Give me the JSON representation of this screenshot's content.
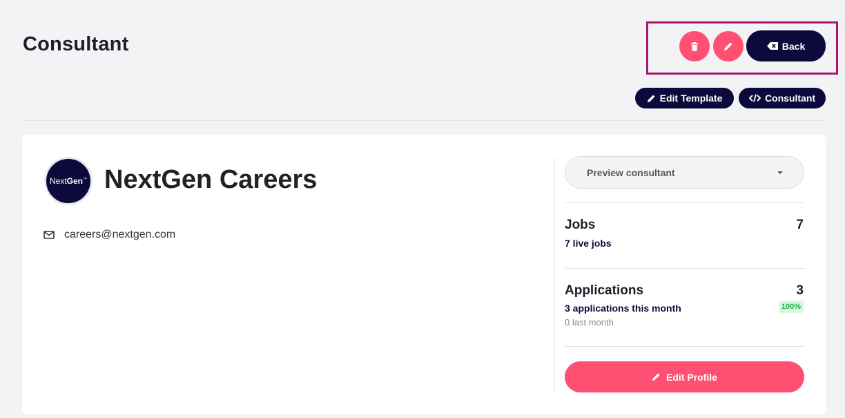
{
  "header": {
    "title": "Consultant",
    "back_label": "Back",
    "edit_template_label": "Edit Template",
    "consultant_label": "Consultant"
  },
  "profile": {
    "avatar_text_light": "Next",
    "avatar_text_bold": "Gen",
    "avatar_mark": "™",
    "company_name": "NextGen Careers",
    "email": "careers@nextgen.com"
  },
  "sidebar": {
    "preview_select_value": "Preview consultant",
    "jobs": {
      "title": "Jobs",
      "count": "7",
      "sub": "7 live jobs"
    },
    "applications": {
      "title": "Applications",
      "count": "3",
      "sub": "3 applications this month",
      "badge": "100%",
      "last_month": "0 last month"
    },
    "edit_profile_label": "Edit Profile"
  },
  "colors": {
    "accent": "#ff4f72",
    "dark": "#0b0a3a",
    "highlight": "#a8166e",
    "success": "#21b14a"
  },
  "icons": [
    "trash-icon",
    "pencil-icon",
    "backspace-icon",
    "code-icon",
    "envelope-icon",
    "caret-down-icon"
  ]
}
